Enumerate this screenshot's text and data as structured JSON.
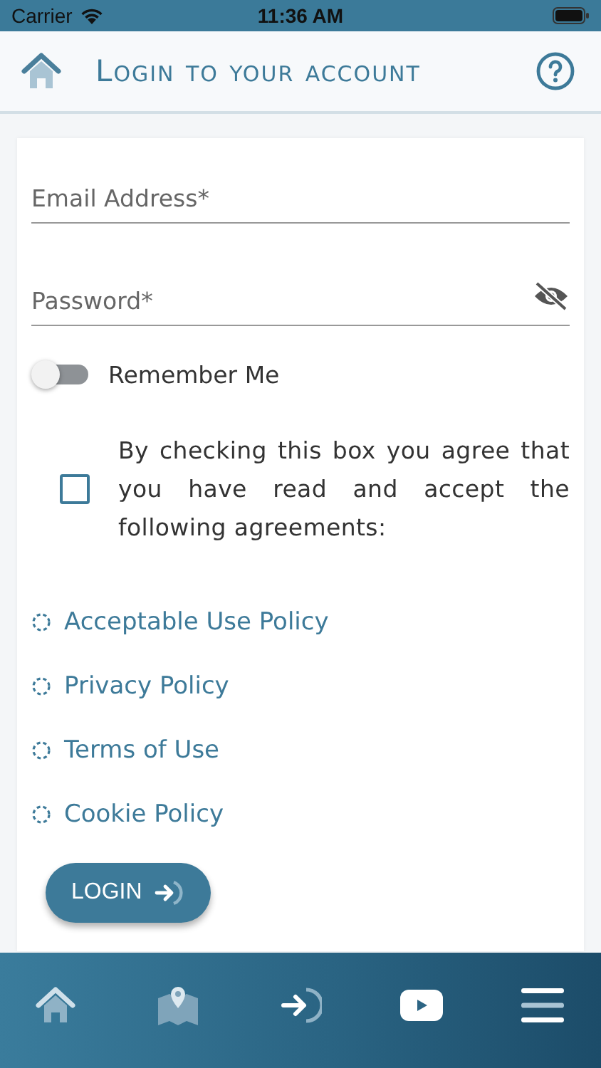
{
  "status_bar": {
    "carrier": "Carrier",
    "time": "11:36 AM"
  },
  "header": {
    "title": "Login to your account"
  },
  "form": {
    "fields": [
      {
        "kind": "email",
        "placeholder": "Email Address*"
      },
      {
        "kind": "password",
        "placeholder": "Password*"
      }
    ],
    "remember": {
      "label": "Remember Me",
      "on": false
    },
    "agreement": {
      "text": "By checking this box you agree that you have read and accept the following agreements:",
      "checked": false
    },
    "links": [
      "Acceptable Use Policy",
      "Privacy Policy",
      "Terms of Use",
      "Cookie Policy"
    ],
    "login_button": "LOGIN"
  },
  "tab_bar": [
    {
      "kind": "home"
    },
    {
      "kind": "map"
    },
    {
      "kind": "login"
    },
    {
      "kind": "video"
    },
    {
      "kind": "menu"
    }
  ]
}
